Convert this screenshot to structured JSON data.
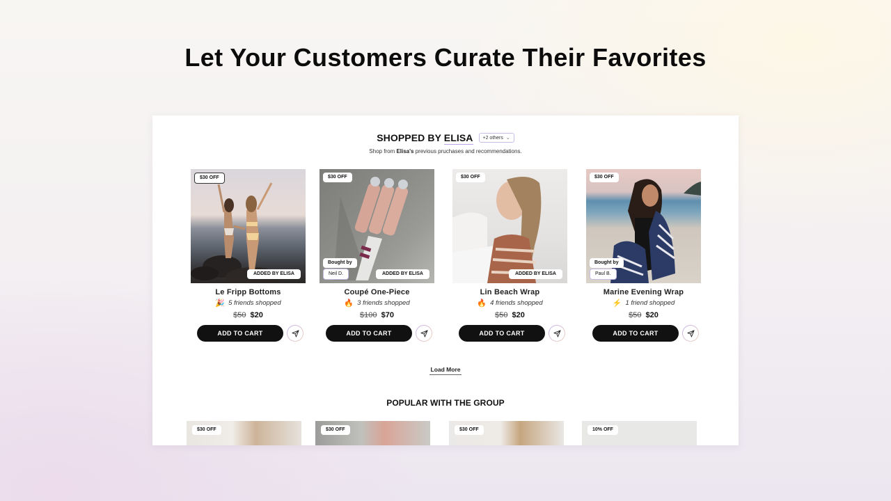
{
  "hero": {
    "title": "Let Your Customers Curate Their Favorites"
  },
  "shopped_by": {
    "title_prefix": "SHOPPED BY",
    "name": "ELISA",
    "others_dropdown": "+2 others",
    "subtitle_prefix": "Shop from",
    "subtitle_name": "Elisa's",
    "subtitle_suffix": "previous pruchases and recommendations."
  },
  "products": [
    {
      "name": "Le Fripp Bottoms",
      "badge": "$30 OFF",
      "added_label": "ADDED BY ELISA",
      "bought_by_label": null,
      "buyer": null,
      "friends_icon": "party-popper-icon",
      "friends_emoji": "🎉",
      "friends_text": "5 friends shopped",
      "old_price": "$50",
      "new_price": "$20",
      "cta": "ADD TO CART"
    },
    {
      "name": "Coupé One-Piece",
      "badge": "$30 OFF",
      "added_label": "ADDED BY ELISA",
      "bought_by_label": "Bought by",
      "buyer": "Neil D.",
      "friends_icon": "fire-icon",
      "friends_emoji": "🔥",
      "friends_text": "3 friends shopped",
      "old_price": "$100",
      "new_price": "$70",
      "cta": "ADD TO CART"
    },
    {
      "name": "Lin Beach Wrap",
      "badge": "$30 OFF",
      "added_label": "ADDED BY ELISA",
      "bought_by_label": null,
      "buyer": null,
      "friends_icon": "fire-icon",
      "friends_emoji": "🔥",
      "friends_text": "4 friends shopped",
      "old_price": "$50",
      "new_price": "$20",
      "cta": "ADD TO CART"
    },
    {
      "name": "Marine Evening Wrap",
      "badge": "$30 OFF",
      "added_label": null,
      "bought_by_label": "Bought by",
      "buyer": "Paul B.",
      "friends_icon": "lightning-icon",
      "friends_emoji": "⚡",
      "friends_text": "1 friend shopped",
      "old_price": "$50",
      "new_price": "$20",
      "cta": "ADD TO CART"
    }
  ],
  "load_more": "Load More",
  "popular": {
    "title": "POPULAR WITH THE GROUP",
    "items": [
      {
        "badge": "$30 OFF"
      },
      {
        "badge": "$30 OFF"
      },
      {
        "badge": "$30 OFF"
      },
      {
        "badge": "10% OFF"
      }
    ]
  }
}
